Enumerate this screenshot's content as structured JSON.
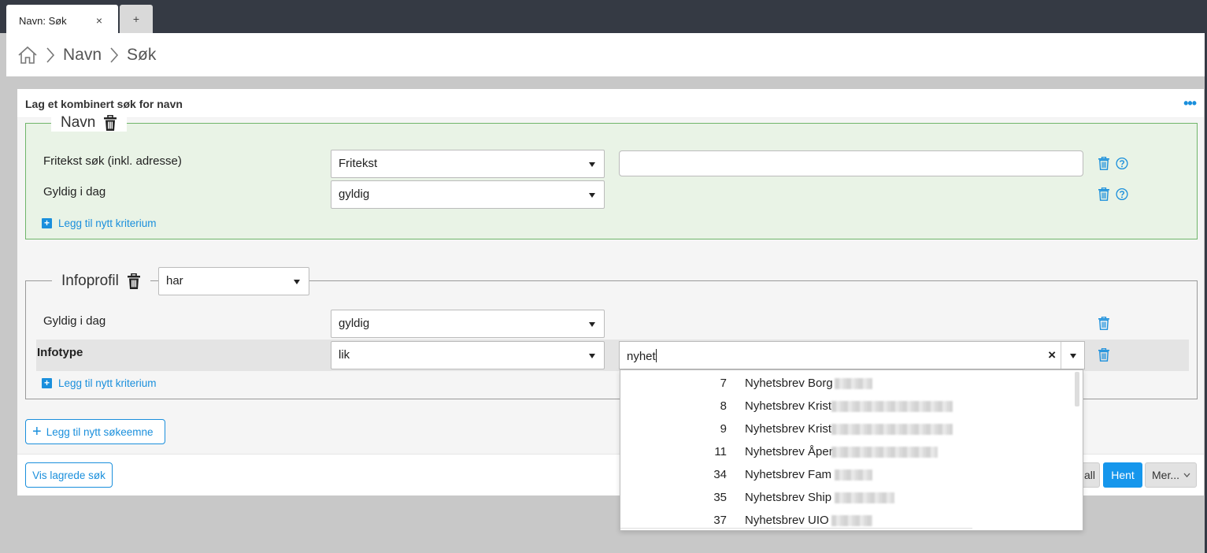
{
  "tabs": [
    {
      "label": "Navn: Søk",
      "close": "×"
    },
    {
      "label": "+"
    }
  ],
  "breadcrumb": {
    "items": [
      "Navn",
      "Søk"
    ]
  },
  "card": {
    "title": "Lag et kombinert søk for navn",
    "menu": "•••"
  },
  "navn_group": {
    "legend": "Navn",
    "rows": [
      {
        "label": "Fritekst søk (inkl. adresse)",
        "operator": "Fritekst",
        "value": ""
      },
      {
        "label": "Gyldig i dag",
        "operator": "gyldig"
      }
    ],
    "add_criterion": "Legg til nytt kriterium"
  },
  "info_group": {
    "legend": "Infoprofil",
    "legend_select": "har",
    "rows": [
      {
        "label": "Gyldig i dag",
        "operator": "gyldig"
      },
      {
        "label": "Infotype",
        "operator": "lik",
        "value": "nyhet"
      }
    ],
    "add_criterion": "Legg til nytt kriterium"
  },
  "add_search_subject": "Legg til nytt søkeemne",
  "footer": {
    "show_saved": "Vis lagrede søk",
    "partial_button": "all",
    "fetch": "Hent",
    "more": "Mer..."
  },
  "dropdown_options": [
    {
      "num": "7",
      "name": "Nyhetsbrev Borg"
    },
    {
      "num": "8",
      "name": "Nyhetsbrev Krist"
    },
    {
      "num": "9",
      "name": "Nyhetsbrev Krist"
    },
    {
      "num": "11",
      "name": "Nyhetsbrev Åper"
    },
    {
      "num": "34",
      "name": "Nyhetsbrev Fam"
    },
    {
      "num": "35",
      "name": "Nyhetsbrev Ship"
    },
    {
      "num": "37",
      "name": "Nyhetsbrev UIO"
    }
  ],
  "colors": {
    "accent": "#1a8fdc",
    "primary_button": "#1596ec",
    "navn_group_bg": "#e9f3e6",
    "navn_group_border": "#6fb56a"
  }
}
